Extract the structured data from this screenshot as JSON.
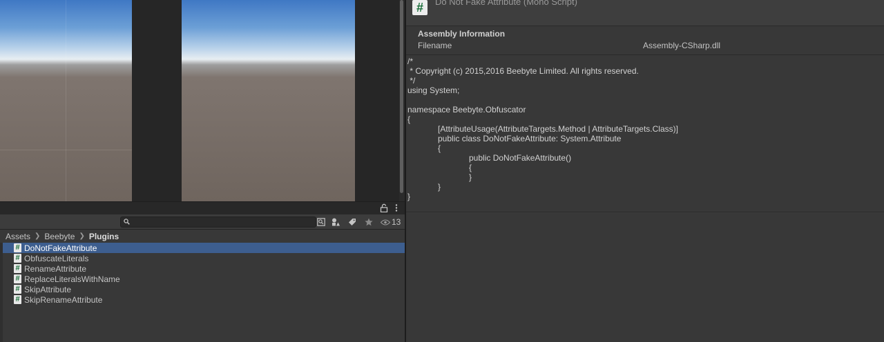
{
  "project": {
    "visible_count": "13",
    "search_placeholder": "",
    "breadcrumb": [
      "Assets",
      "Beebyte",
      "Plugins"
    ],
    "files": [
      {
        "icon": "#",
        "name": "DoNotFakeAttribute",
        "selected": true
      },
      {
        "icon": "#",
        "name": "ObfuscateLiterals",
        "selected": false
      },
      {
        "icon": "#",
        "name": "RenameAttribute",
        "selected": false
      },
      {
        "icon": "#",
        "name": "ReplaceLiteralsWithName",
        "selected": false
      },
      {
        "icon": "#",
        "name": "SkipAttribute",
        "selected": false
      },
      {
        "icon": "#",
        "name": "SkipRenameAttribute",
        "selected": false
      }
    ]
  },
  "inspector": {
    "script_icon": "#",
    "title": "Do Not Fake Attribute (Mono Script)",
    "assembly": {
      "heading": "Assembly Information",
      "filename_label": "Filename",
      "filename_value": "Assembly-CSharp.dll"
    },
    "code_lines": [
      "/*",
      " * Copyright (c) 2015,2016 Beebyte Limited. All rights reserved.",
      " */",
      "using System;",
      "",
      "namespace Beebyte.Obfuscator",
      "{",
      "[AttributeUsage(AttributeTargets.Method | AttributeTargets.Class)]",
      "public class DoNotFakeAttribute: System.Attribute",
      "{",
      "public DoNotFakeAttribute()",
      "{",
      "}",
      "}",
      "}"
    ]
  },
  "colors": {
    "selection": "#3d5e8f",
    "panel_bg": "#383838",
    "script_icon_green": "#1a6e3a"
  },
  "icons": [
    "lock-icon",
    "kebab-menu-icon",
    "search-icon",
    "save-search-icon",
    "filter-type-icon",
    "filter-label-icon",
    "favorite-star-icon",
    "eye-icon",
    "csharp-script-icon",
    "chevron-right-icon"
  ]
}
